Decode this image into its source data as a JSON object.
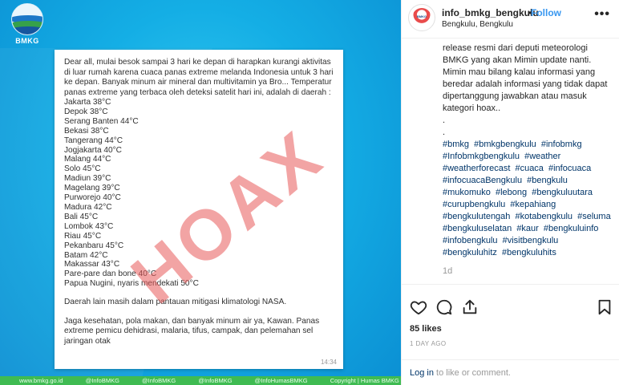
{
  "image": {
    "logo_text": "BMKG",
    "note": {
      "paragraph": "Dear all, mulai besok sampai 3 hari ke depan di harapkan kurangi aktivitas di luar rumah karena cuaca panas extreme melanda Indonesia untuk 3 hari ke depan. Banyak minum air mineral dan multivitamin ya Bro... Temperatur panas extreme yang terbaca oleh deteksi satelit hari ini, adalah di daerah :",
      "cities": [
        "Jakarta 38°C",
        "Depok 38°C",
        "Serang Banten 44°C",
        "Bekasi 38°C",
        "Tangerang 44°C",
        "Jogjakarta 40°C",
        "Malang 44°C",
        "Solo 45°C",
        "Madiun 39°C",
        "Magelang 39°C",
        "Purworejo 40°C",
        "Madura 42°C",
        "Bali 45°C",
        "Lombok 43°C",
        "Riau 45°C",
        "Pekanbaru 45°C",
        "Batam 42°C",
        "Makassar 43°C",
        "Pare-pare dan bone 40°C",
        "Papua Nugini, nyaris mendekati 50°C"
      ],
      "closing_1": "Daerah lain masih dalam pantauan mitigasi klimatologi NASA.",
      "closing_2": "Jaga kesehatan, pola makan, dan banyak minum air ya, Kawan. Panas extreme pemicu dehidrasi, malaria, tifus, campak, dan pelemahan sel jaringan otak",
      "time": "14:34"
    },
    "stamp": "HOAX",
    "footer_items": [
      "www.bmkg.go.id",
      "@InfoBMKG",
      "@InfoBMKG",
      "@InfoBMKG",
      "@InfoHumasBMKG",
      "Copyright | Humas BMKG"
    ]
  },
  "header": {
    "username": "info_bmkg_bengkulu",
    "separator": "•",
    "follow_label": "Follow",
    "location": "Bengkulu, Bengkulu",
    "more_label": "•••",
    "avatar_text": "BMKG"
  },
  "caption": {
    "lines": [
      "release resmi dari deputi meteorologi BMKG yang akan Mimin update nanti. Mimin mau bilang kalau informasi yang beredar adalah informasi yang tidak dapat dipertanggung jawabkan atau masuk kategori hoax..",
      ".",
      "."
    ],
    "hashtags": [
      "#bmkg",
      "#bmkgbengkulu",
      "#infobmkg",
      "#Infobmkgbengkulu",
      "#weather",
      "#weatherforecast",
      "#cuaca",
      "#infocuaca",
      "#infocuacaBengkulu",
      "#bengkulu",
      "#mukomuko",
      "#lebong",
      "#bengkuluutara",
      "#curupbengkulu",
      "#kepahiang",
      "#bengkulutengah",
      "#kotabengkulu",
      "#seluma",
      "#bengkuluselatan",
      "#kaur",
      "#bengkuluinfo",
      "#infobengkulu",
      "#visitbengkulu",
      "#bengkuluhitz",
      "#bengkuluhits"
    ],
    "time_ago": "1d"
  },
  "footer": {
    "likes": "85 likes",
    "date": "1 DAY AGO",
    "login_link": "Log in",
    "login_suffix": " to like or comment."
  },
  "colors": {
    "link_blue": "#3897f0",
    "hashtag_navy": "#003569",
    "bmkg_blue": "#14aee5",
    "stamp_red": "#e85a5a"
  },
  "icons": [
    "heart-icon",
    "comment-icon",
    "share-icon",
    "bookmark-icon"
  ]
}
